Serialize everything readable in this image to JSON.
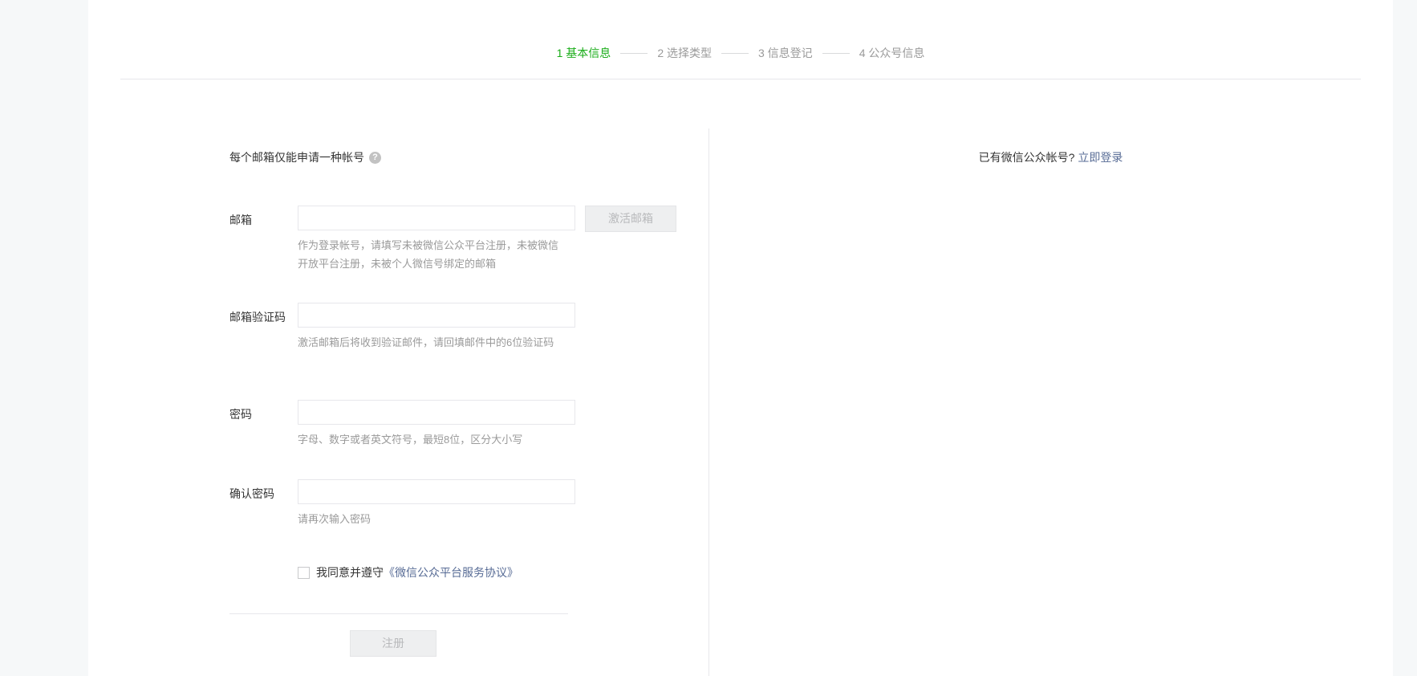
{
  "steps": [
    {
      "label": "1 基本信息",
      "active": true
    },
    {
      "label": "2 选择类型",
      "active": false
    },
    {
      "label": "3 信息登记",
      "active": false
    },
    {
      "label": "4 公众号信息",
      "active": false
    }
  ],
  "notice": "每个邮箱仅能申请一种帐号",
  "help_icon_glyph": "?",
  "fields": {
    "email": {
      "label": "邮箱",
      "value": "",
      "tip": "作为登录帐号，请填写未被微信公众平台注册，未被微信开放平台注册，未被个人微信号绑定的邮箱",
      "activate_button": "激活邮箱"
    },
    "email_code": {
      "label": "邮箱验证码",
      "value": "",
      "tip": "激活邮箱后将收到验证邮件，请回填邮件中的6位验证码"
    },
    "password": {
      "label": "密码",
      "value": "",
      "tip": "字母、数字或者英文符号，最短8位，区分大小写"
    },
    "confirm_password": {
      "label": "确认密码",
      "value": "",
      "tip": "请再次输入密码"
    }
  },
  "agreement": {
    "prefix": "我同意并遵守",
    "link": "《微信公众平台服务协议》",
    "checked": false
  },
  "register_button": "注册",
  "login_hint": {
    "text": "已有微信公众帐号?",
    "link": "立即登录"
  },
  "colors": {
    "active_step": "#1aad19",
    "link": "#576b95",
    "muted_text": "#9a9a9a",
    "disabled_button_bg": "#eeeff0"
  }
}
